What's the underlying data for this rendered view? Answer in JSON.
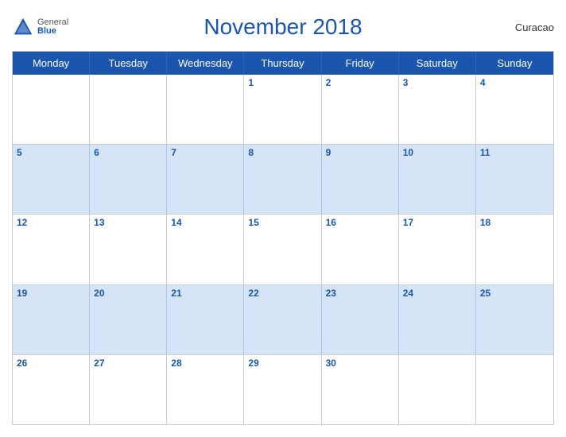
{
  "header": {
    "logo": {
      "general": "General",
      "blue": "Blue"
    },
    "title": "November 2018",
    "country": "Curacao"
  },
  "dayHeaders": [
    "Monday",
    "Tuesday",
    "Wednesday",
    "Thursday",
    "Friday",
    "Saturday",
    "Sunday"
  ],
  "weeks": [
    [
      {
        "num": "",
        "empty": true
      },
      {
        "num": "",
        "empty": true
      },
      {
        "num": "",
        "empty": true
      },
      {
        "num": "1",
        "empty": false
      },
      {
        "num": "2",
        "empty": false
      },
      {
        "num": "3",
        "empty": false
      },
      {
        "num": "4",
        "empty": false
      }
    ],
    [
      {
        "num": "5",
        "empty": false
      },
      {
        "num": "6",
        "empty": false
      },
      {
        "num": "7",
        "empty": false
      },
      {
        "num": "8",
        "empty": false
      },
      {
        "num": "9",
        "empty": false
      },
      {
        "num": "10",
        "empty": false
      },
      {
        "num": "11",
        "empty": false
      }
    ],
    [
      {
        "num": "12",
        "empty": false
      },
      {
        "num": "13",
        "empty": false
      },
      {
        "num": "14",
        "empty": false
      },
      {
        "num": "15",
        "empty": false
      },
      {
        "num": "16",
        "empty": false
      },
      {
        "num": "17",
        "empty": false
      },
      {
        "num": "18",
        "empty": false
      }
    ],
    [
      {
        "num": "19",
        "empty": false
      },
      {
        "num": "20",
        "empty": false
      },
      {
        "num": "21",
        "empty": false
      },
      {
        "num": "22",
        "empty": false
      },
      {
        "num": "23",
        "empty": false
      },
      {
        "num": "24",
        "empty": false
      },
      {
        "num": "25",
        "empty": false
      }
    ],
    [
      {
        "num": "26",
        "empty": false
      },
      {
        "num": "27",
        "empty": false
      },
      {
        "num": "28",
        "empty": false
      },
      {
        "num": "29",
        "empty": false
      },
      {
        "num": "30",
        "empty": false
      },
      {
        "num": "",
        "empty": true
      },
      {
        "num": "",
        "empty": true
      }
    ]
  ],
  "colors": {
    "header_bg": "#1a56b0",
    "row_even_bg": "#d6e4f7",
    "row_odd_bg": "#ffffff",
    "day_num_color": "#1a56b0"
  }
}
